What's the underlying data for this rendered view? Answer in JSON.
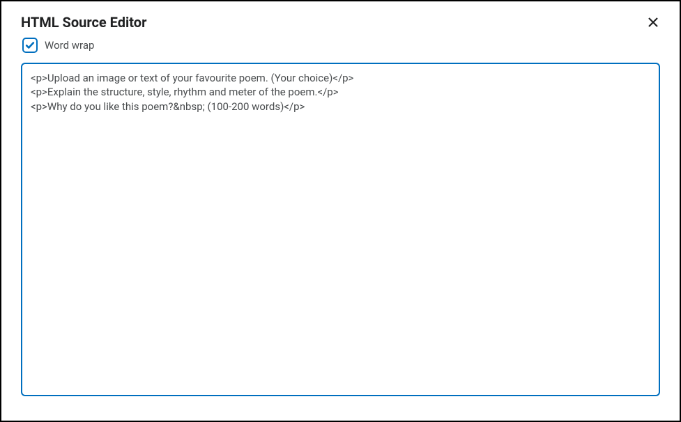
{
  "dialog": {
    "title": "HTML Source Editor",
    "wordwrap_label": "Word wrap",
    "wordwrap_checked": true,
    "source_content": "<p>Upload an image or text of your favourite poem. (Your choice)</p>\n<p>Explain the structure, style, rhythm and meter of the poem.</p>\n<p>Why do you like this poem?&nbsp; (100-200 words)</p>"
  }
}
